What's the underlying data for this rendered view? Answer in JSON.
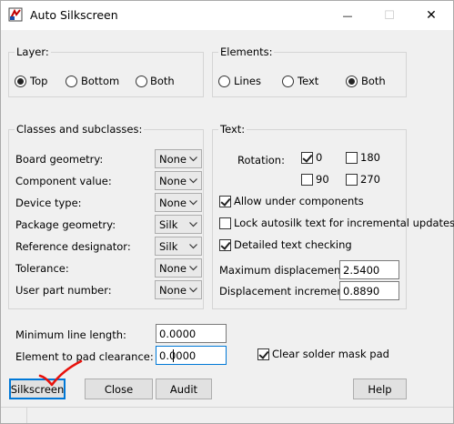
{
  "window": {
    "title": "Auto Silkscreen"
  },
  "titlebar": {
    "minimize_glyph": "—",
    "maximize_glyph": "☐",
    "close_glyph": "✕"
  },
  "layer": {
    "legend": "Layer:",
    "options": [
      "Top",
      "Bottom",
      "Both"
    ],
    "selected": "Top"
  },
  "elements": {
    "legend": "Elements:",
    "options": [
      "Lines",
      "Text",
      "Both"
    ],
    "selected": "Both"
  },
  "classes": {
    "legend": "Classes and subclasses:",
    "rows": [
      {
        "label": "Board geometry:",
        "value": "None"
      },
      {
        "label": "Component value:",
        "value": "None"
      },
      {
        "label": "Device type:",
        "value": "None"
      },
      {
        "label": "Package geometry:",
        "value": "Silk"
      },
      {
        "label": "Reference designator:",
        "value": "Silk"
      },
      {
        "label": "Tolerance:",
        "value": "None"
      },
      {
        "label": "User part number:",
        "value": "None"
      }
    ]
  },
  "text": {
    "legend": "Text:",
    "rotation_label": "Rotation:",
    "rotations": [
      {
        "label": "0",
        "checked": true
      },
      {
        "label": "180",
        "checked": false
      },
      {
        "label": "90",
        "checked": false
      },
      {
        "label": "270",
        "checked": false
      }
    ],
    "allow_under_components": {
      "label": "Allow under components",
      "checked": true
    },
    "lock_autosilk": {
      "label": "Lock autosilk text for incremental updates",
      "checked": false
    },
    "detailed_checking": {
      "label": "Detailed text checking",
      "checked": true
    },
    "max_displacement": {
      "label": "Maximum displacement:",
      "value": "2.5400"
    },
    "displacement_increment": {
      "label": "Displacement increment:",
      "value": "0.8890"
    }
  },
  "bottom": {
    "min_line_length": {
      "label": "Minimum line length:",
      "value": "0.0000"
    },
    "pad_clearance": {
      "label": "Element to pad clearance:",
      "value": "0.0000"
    },
    "clear_solder_mask": {
      "label": "Clear solder mask pad",
      "checked": true
    }
  },
  "buttons": {
    "silkscreen": "Silkscreen",
    "close": "Close",
    "audit": "Audit",
    "help": "Help"
  },
  "colors": {
    "annotation": "#e8120c",
    "focus": "#0078d7"
  }
}
